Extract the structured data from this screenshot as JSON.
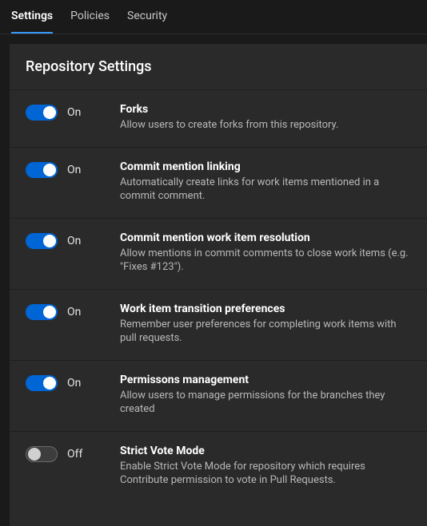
{
  "tabs": {
    "settings": "Settings",
    "policies": "Policies",
    "security": "Security",
    "active": "settings"
  },
  "panel": {
    "title": "Repository Settings"
  },
  "labels": {
    "on": "On",
    "off": "Off"
  },
  "settings": {
    "forks": {
      "state": "on",
      "title": "Forks",
      "desc": "Allow users to create forks from this repository."
    },
    "commit_mention_linking": {
      "state": "on",
      "title": "Commit mention linking",
      "desc": "Automatically create links for work items mentioned in a commit comment."
    },
    "commit_mention_resolution": {
      "state": "on",
      "title": "Commit mention work item resolution",
      "desc": "Allow mentions in commit comments to close work items (e.g. \"Fixes #123\")."
    },
    "work_item_transition": {
      "state": "on",
      "title": "Work item transition preferences",
      "desc": "Remember user preferences for completing work items with pull requests."
    },
    "permissions_management": {
      "state": "on",
      "title": "Permissons management",
      "desc": "Allow users to manage permissions for the branches they created"
    },
    "strict_vote_mode": {
      "state": "off",
      "title": "Strict Vote Mode",
      "desc": "Enable Strict Vote Mode for repository which requires Contribute permission to vote in Pull Requests."
    }
  }
}
